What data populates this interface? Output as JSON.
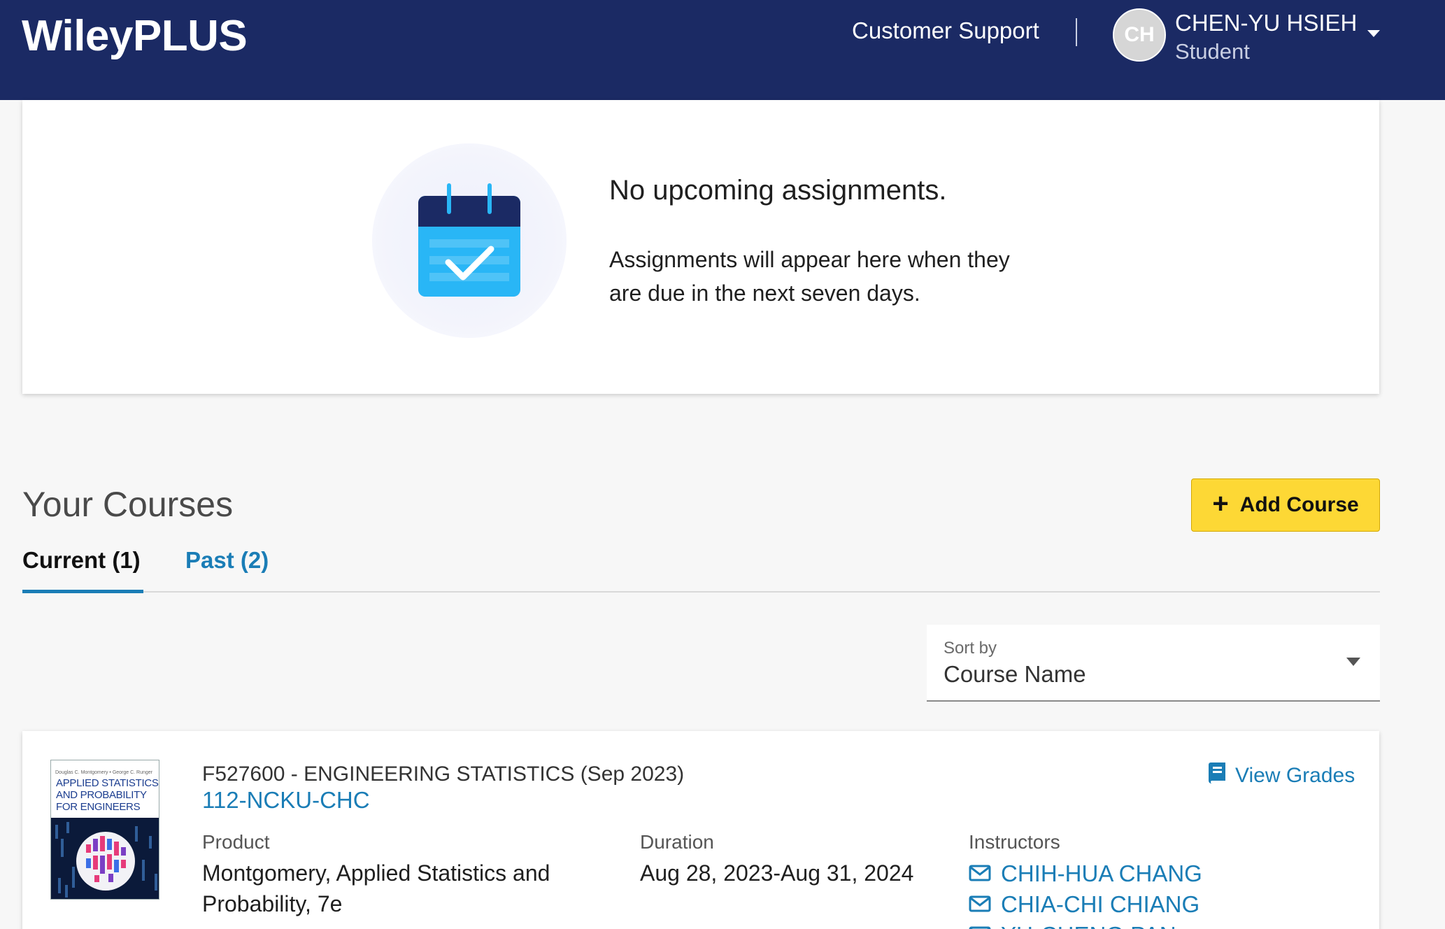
{
  "header": {
    "logo": "WileyPLUS",
    "support_link": "Customer Support",
    "avatar_initials": "CH",
    "user_name": "CHEN-YU HSIEH",
    "user_role": "Student"
  },
  "assignments": {
    "title": "No upcoming assignments.",
    "description": "Assignments will appear here when they are due in the next seven days."
  },
  "courses": {
    "title": "Your Courses",
    "add_button": "Add Course",
    "tabs": [
      {
        "label": "Current (1)",
        "active": true
      },
      {
        "label": "Past (2)",
        "active": false
      }
    ],
    "sort": {
      "label": "Sort by",
      "value": "Course Name"
    },
    "items": [
      {
        "cover_title": "APPLIED STATISTICS AND PROBABILITY FOR ENGINEERS",
        "cover_authors": "Douglas C. Montgomery • George C. Runger",
        "code": "F527600 - ENGINEERING STATISTICS (Sep 2023)",
        "name": "112-NCKU-CHC",
        "view_grades": "View Grades",
        "product_label": "Product",
        "product_value": "Montgomery, Applied Statistics and Probability, 7e",
        "duration_label": "Duration",
        "duration_value": "Aug 28, 2023-Aug 31, 2024",
        "instructors_label": "Instructors",
        "instructors": [
          "CHIH-HUA CHANG",
          "CHIA-CHI CHIANG",
          "YU-CHENG PAN"
        ]
      }
    ]
  },
  "colors": {
    "header_bg": "#1b2a64",
    "link": "#1a7db6",
    "accent_button": "#fdd835",
    "calendar_dark": "#1b2a64",
    "calendar_light": "#29b6f6"
  }
}
